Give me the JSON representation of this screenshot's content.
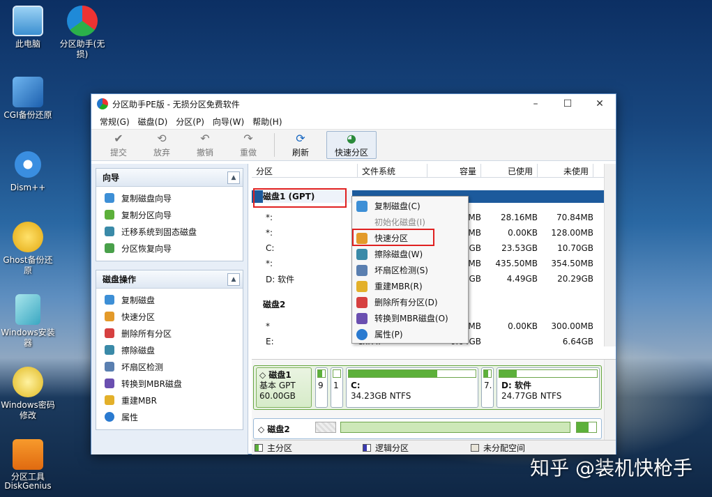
{
  "desktop": {
    "icons": [
      {
        "label": "此电脑",
        "icon": "computer-icon"
      },
      {
        "label": "分区助手(无损)",
        "icon": "partition-assistant-icon"
      },
      {
        "label": "CGI备份还原",
        "icon": "cgi-backup-icon"
      },
      {
        "label": "Dism++",
        "icon": "dism-gears-icon"
      },
      {
        "label": "Ghost备份还原",
        "icon": "ghost-icon"
      },
      {
        "label": "Windows安装器",
        "icon": "windows-installer-icon"
      },
      {
        "label": "Windows密码修改",
        "icon": "key-icon"
      },
      {
        "label": "分区工具DiskGenius",
        "icon": "diskgenius-icon"
      }
    ],
    "watermark": "知乎 @装机快枪手"
  },
  "window": {
    "title": "分区助手PE版 - 无损分区免费软件",
    "controls": {
      "minimize": "–",
      "maximize": "☐",
      "close": "✕"
    }
  },
  "menu": [
    "常规(G)",
    "磁盘(D)",
    "分区(P)",
    "向导(W)",
    "帮助(H)"
  ],
  "toolbar": [
    {
      "label": "提交",
      "icon": "check-icon",
      "glyph": "✔"
    },
    {
      "label": "放弃",
      "icon": "discard-icon",
      "glyph": "⟲"
    },
    {
      "label": "撤销",
      "icon": "undo-icon",
      "glyph": "↶"
    },
    {
      "label": "重做",
      "icon": "redo-icon",
      "glyph": "↷"
    },
    {
      "label": "刷新",
      "icon": "refresh-icon",
      "glyph": "⟳"
    },
    {
      "label": "快速分区",
      "icon": "quick-partition-icon",
      "glyph": "◕"
    }
  ],
  "wizard_panel": {
    "title": "向导",
    "items": [
      "复制磁盘向导",
      "复制分区向导",
      "迁移系统到固态磁盘",
      "分区恢复向导"
    ]
  },
  "disk_ops_panel": {
    "title": "磁盘操作",
    "items": [
      "复制磁盘",
      "快速分区",
      "删除所有分区",
      "擦除磁盘",
      "坏扇区检测",
      "转换到MBR磁盘",
      "重建MBR",
      "属性"
    ]
  },
  "grid": {
    "headers": [
      "分区",
      "文件系统",
      "容量",
      "已使用",
      "未使用"
    ],
    "disk1_label": "磁盘1 (GPT)",
    "disk2_label": "磁盘2",
    "rows1": [
      {
        "part": "*:",
        "fs": "",
        "cap": "MB",
        "used": "28.16MB",
        "free": "70.84MB"
      },
      {
        "part": "*:",
        "fs": "",
        "cap": "MB",
        "used": "0.00KB",
        "free": "128.00MB"
      },
      {
        "part": "C:",
        "fs": "",
        "cap": "GB",
        "used": "23.53GB",
        "free": "10.70GB"
      },
      {
        "part": "*:",
        "fs": "",
        "cap": "MB",
        "used": "435.50MB",
        "free": "354.50MB"
      },
      {
        "part": "D: 软件",
        "fs": "",
        "cap": "GB",
        "used": "4.49GB",
        "free": "20.29GB"
      }
    ],
    "rows2": [
      {
        "part": "*",
        "fs": "",
        "cap": "MB",
        "used": "0.00KB",
        "free": "300.00MB"
      },
      {
        "part": "E:",
        "fs": "exFAT",
        "cap": "6.64GB",
        "used": "",
        "free": "6.64GB"
      }
    ]
  },
  "context_menu": [
    {
      "label": "复制磁盘(C)",
      "enabled": true
    },
    {
      "label": "初始化磁盘(I)",
      "enabled": false
    },
    {
      "label": "快速分区",
      "enabled": true
    },
    {
      "label": "擦除磁盘(W)",
      "enabled": true
    },
    {
      "label": "坏扇区检测(S)",
      "enabled": true
    },
    {
      "label": "重建MBR(R)",
      "enabled": true
    },
    {
      "label": "删除所有分区(D)",
      "enabled": true
    },
    {
      "label": "转换到MBR磁盘(O)",
      "enabled": true
    },
    {
      "label": "属性(P)",
      "enabled": true
    }
  ],
  "disk_map": {
    "disk1": {
      "name": "磁盘1",
      "type": "基本 GPT",
      "size": "60.00GB",
      "small": [
        "9",
        "1"
      ],
      "c": {
        "label": "C:",
        "detail": "34.23GB NTFS",
        "fill": 0.7
      },
      "mid": "7.",
      "d": {
        "label": "D: 软件",
        "detail": "24.77GB NTFS",
        "fill": 0.18
      }
    },
    "disk2": {
      "name": "磁盘2"
    }
  },
  "legend": [
    "主分区",
    "逻辑分区",
    "未分配空间"
  ],
  "colors": {
    "primary": "#5cb03a",
    "logical": "#3a3ab0",
    "unallocated": "#e8e4d8",
    "highlight": "#e02020",
    "selection": "#1c5a9c"
  }
}
